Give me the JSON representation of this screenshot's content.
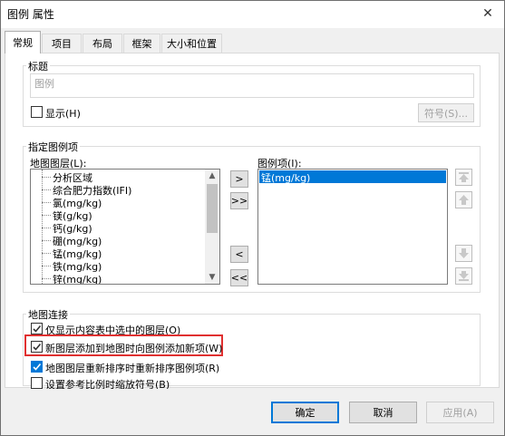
{
  "window": {
    "title": "图例 属性",
    "close_glyph": "✕"
  },
  "tabs": [
    {
      "label": "常规",
      "active": true
    },
    {
      "label": "项目",
      "active": false
    },
    {
      "label": "布局",
      "active": false
    },
    {
      "label": "框架",
      "active": false
    },
    {
      "label": "大小和位置",
      "active": false
    }
  ],
  "title_group": {
    "label": "标题",
    "placeholder": "图例",
    "show_checkbox": {
      "label": "显示(H)",
      "checked": false
    },
    "symbol_button": "符号(S)..."
  },
  "legend_items_group": {
    "label": "指定图例项",
    "map_layers_label": "地图图层(L):",
    "map_layers": [
      "分析区域",
      "综合肥力指数(IFI)",
      "氯(mg/kg)",
      "镁(g/kg)",
      "钙(g/kg)",
      "硼(mg/kg)",
      "锰(mg/kg)",
      "铁(mg/kg)",
      "锌(mg/kg)"
    ],
    "legend_items_label": "图例项(I):",
    "legend_items": [
      "锰(mg/kg)"
    ],
    "move_buttons": {
      "add": ">",
      "add_all": ">>",
      "remove": "<",
      "remove_all": "<<"
    },
    "order_icons": [
      "top-icon",
      "up-icon",
      "down-icon",
      "bottom-icon"
    ]
  },
  "map_link_group": {
    "label": "地图连接",
    "options": [
      {
        "label": "仅显示内容表中选中的图层(O)",
        "checked": true
      },
      {
        "label": "新图层添加到地图时向图例添加新项(W)",
        "checked": true
      },
      {
        "label": "地图图层重新排序时重新排序图例项(R)",
        "checked": true
      },
      {
        "label": "设置参考比例时缩放符号(B)",
        "checked": false
      }
    ]
  },
  "footer": {
    "ok": "确定",
    "cancel": "取消",
    "apply": "应用(A)"
  },
  "colors": {
    "selection": "#0078d7",
    "highlight_border": "#e03030",
    "check": "#0078d7"
  }
}
